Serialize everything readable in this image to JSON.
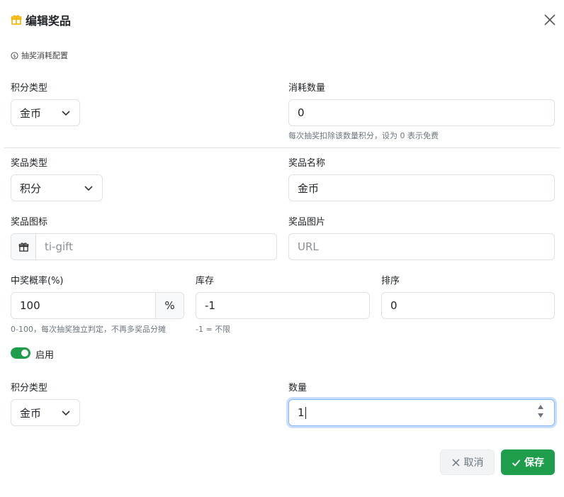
{
  "dialog": {
    "title": "编辑奖品",
    "title_icon": "gift-icon",
    "close_icon": "close-icon"
  },
  "cost_section": {
    "label": "抽奖消耗配置",
    "icon": "coin-icon",
    "points_type_label": "积分类型",
    "points_type_value": "金币",
    "cost_amount_label": "消耗数量",
    "cost_amount_value": "0",
    "cost_amount_hint": "每次抽奖扣除该数量积分，设为 0 表示免费"
  },
  "prize": {
    "type_label": "奖品类型",
    "type_value": "积分",
    "name_label": "奖品名称",
    "name_value": "金币",
    "icon_label": "奖品图标",
    "icon_placeholder": "ti-gift",
    "image_label": "奖品图片",
    "image_placeholder": "URL",
    "probability_label": "中奖概率(%)",
    "probability_value": "100",
    "probability_unit": "%",
    "probability_hint": "0-100，每次抽奖独立判定，不再多奖品分摊",
    "stock_label": "库存",
    "stock_value": "-1",
    "stock_hint": "-1 = 不限",
    "sort_label": "排序",
    "sort_value": "0",
    "enabled_label": "启用",
    "enabled": true
  },
  "reward": {
    "points_type_label": "积分类型",
    "points_type_value": "金币",
    "quantity_label": "数量",
    "quantity_value": "1"
  },
  "footer": {
    "cancel_label": "取消",
    "save_label": "保存"
  },
  "colors": {
    "primary": "#1e9e4a",
    "icon_yellow": "#f0b400",
    "border": "#dee2e6",
    "focus": "#86b7fe"
  }
}
